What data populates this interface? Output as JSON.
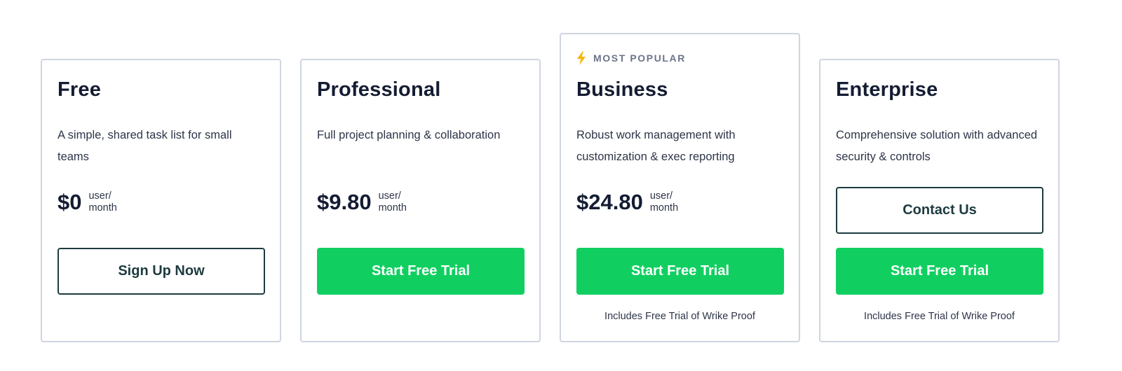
{
  "plans": [
    {
      "name": "Free",
      "description": "A simple, shared task list for small teams",
      "price": "$0",
      "price_unit": "user/ month",
      "cta": "Sign Up Now"
    },
    {
      "name": "Professional",
      "description": "Full project planning & collaboration",
      "price": "$9.80",
      "price_unit": "user/ month",
      "cta": "Start Free Trial"
    },
    {
      "badge": "MOST POPULAR",
      "badge_icon": "lightning-bolt-icon",
      "name": "Business",
      "description": "Robust work management with customization & exec reporting",
      "price": "$24.80",
      "price_unit": "user/ month",
      "cta": "Start Free Trial",
      "note": "Includes Free Trial of Wrike Proof"
    },
    {
      "name": "Enterprise",
      "description": "Comprehensive solution with advanced security & controls",
      "secondary_cta": "Contact Us",
      "cta": "Start Free Trial",
      "note": "Includes Free Trial of Wrike Proof"
    }
  ],
  "colors": {
    "primary_button": "#10cf60",
    "outline_button": "#1d3b40",
    "card_border": "#cfd5e0",
    "badge_icon": "#f5b400",
    "heading": "#141c33"
  }
}
